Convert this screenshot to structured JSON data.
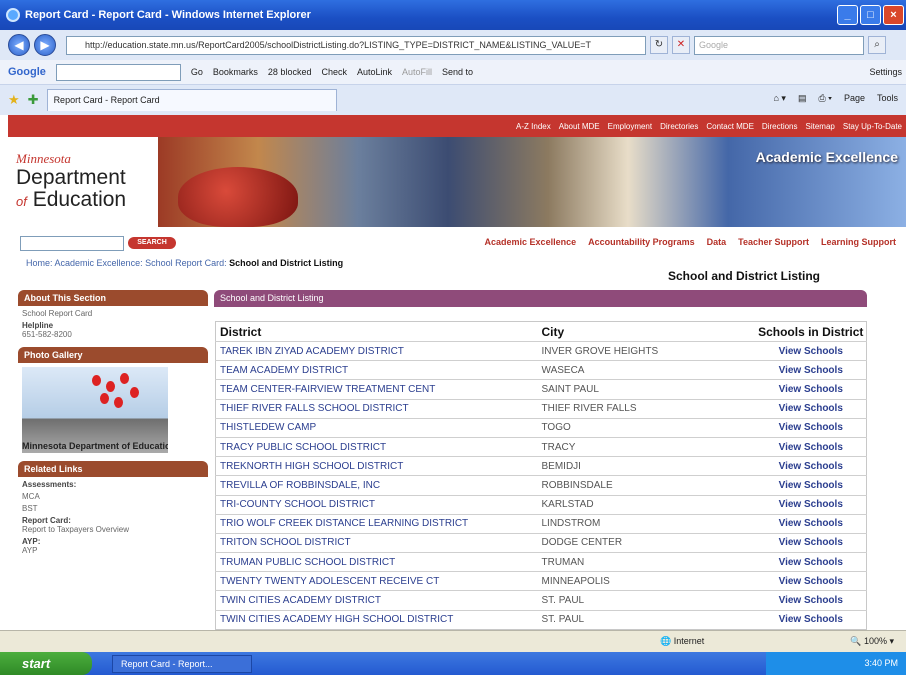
{
  "window": {
    "title": "Report Card - Report Card - Windows Internet Explorer",
    "address": "http://education.state.mn.us/ReportCard2005/schoolDistrictListing.do?LISTING_TYPE=DISTRICT_NAME&LISTING_VALUE=T",
    "search_placeholder": "Google"
  },
  "google_toolbar": {
    "go": "Go",
    "bookmarks": "Bookmarks",
    "blocked": "28 blocked",
    "check": "Check",
    "autolink": "AutoLink",
    "autofill": "AutoFill",
    "send_to": "Send to",
    "settings": "Settings"
  },
  "tab": {
    "label": "Report Card - Report Card",
    "page_menu": "Page",
    "tools_menu": "Tools"
  },
  "site": {
    "top_links": [
      "A-Z Index",
      "About MDE",
      "Employment",
      "Directories",
      "Contact MDE",
      "Directions",
      "Sitemap",
      "Stay Up-To-Date"
    ],
    "logo_state": "Minnesota",
    "logo_dept": "Department",
    "logo_of": "of",
    "logo_ed": "Education",
    "banner_title": "Academic Excellence",
    "search_button": "SEARCH",
    "main_nav": [
      "Academic Excellence",
      "Accountability Programs",
      "Data",
      "Teacher Support",
      "Learning Support"
    ],
    "breadcrumb": {
      "home": "Home:",
      "acad": "Academic Excellence:",
      "rc": "School Report Card:",
      "current": "School and District Listing"
    },
    "page_title": "School and District Listing"
  },
  "sidebar": {
    "about_header": "About This Section",
    "about_link": "School Report Card",
    "helpline_label": "Helpline",
    "helpline_number": "651-582-8200",
    "photo_header": "Photo Gallery",
    "photo_caption": "Minnesota Department of Education",
    "related_header": "Related Links",
    "assessments_label": "Assessments:",
    "mca": "MCA",
    "bst": "BST",
    "report_card_label": "Report Card:",
    "taxpayers": "Report to Taxpayers Overview",
    "ayp_label": "AYP:",
    "ayp": "AYP"
  },
  "main": {
    "header": "School and District Listing",
    "columns": [
      "District",
      "City",
      "Schools in District"
    ],
    "rows": [
      {
        "district": "TAREK IBN ZIYAD ACADEMY DISTRICT",
        "city": "INVER GROVE HEIGHTS",
        "link": "View Schools"
      },
      {
        "district": "TEAM ACADEMY DISTRICT",
        "city": "WASECA",
        "link": "View Schools"
      },
      {
        "district": "TEAM CENTER-FAIRVIEW TREATMENT CENT",
        "city": "SAINT PAUL",
        "link": "View Schools"
      },
      {
        "district": "THIEF RIVER FALLS SCHOOL DISTRICT",
        "city": "THIEF RIVER FALLS",
        "link": "View Schools"
      },
      {
        "district": "THISTLEDEW CAMP",
        "city": "TOGO",
        "link": "View Schools"
      },
      {
        "district": "TRACY PUBLIC SCHOOL DISTRICT",
        "city": "TRACY",
        "link": "View Schools"
      },
      {
        "district": "TREKNORTH HIGH SCHOOL DISTRICT",
        "city": "BEMIDJI",
        "link": "View Schools"
      },
      {
        "district": "TREVILLA OF ROBBINSDALE, INC",
        "city": "ROBBINSDALE",
        "link": "View Schools"
      },
      {
        "district": "TRI-COUNTY SCHOOL DISTRICT",
        "city": "KARLSTAD",
        "link": "View Schools"
      },
      {
        "district": "TRIO WOLF CREEK DISTANCE LEARNING DISTRICT",
        "city": "LINDSTROM",
        "link": "View Schools"
      },
      {
        "district": "TRITON SCHOOL DISTRICT",
        "city": "DODGE CENTER",
        "link": "View Schools"
      },
      {
        "district": "TRUMAN PUBLIC SCHOOL DISTRICT",
        "city": "TRUMAN",
        "link": "View Schools"
      },
      {
        "district": "TWENTY TWENTY ADOLESCENT RECEIVE CT",
        "city": "MINNEAPOLIS",
        "link": "View Schools"
      },
      {
        "district": "TWIN CITIES ACADEMY DISTRICT",
        "city": "ST. PAUL",
        "link": "View Schools"
      },
      {
        "district": "TWIN CITIES ACADEMY HIGH SCHOOL DISTRICT",
        "city": "ST. PAUL",
        "link": "View Schools"
      }
    ]
  },
  "statusbar": {
    "zone": "Internet",
    "zoom": "100%"
  },
  "taskbar": {
    "start": "start",
    "item": "Report Card - Report...",
    "clock": "3:40 PM"
  }
}
